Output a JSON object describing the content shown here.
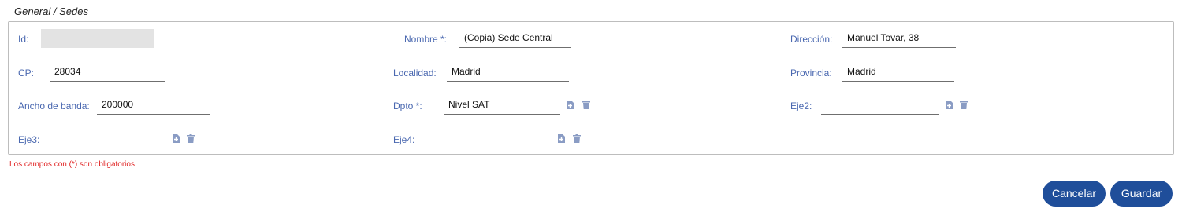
{
  "breadcrumb": "General / Sedes",
  "fields": {
    "id": {
      "label": "Id:",
      "value": ""
    },
    "nombre": {
      "label": "Nombre *:",
      "value": "(Copia) Sede Central"
    },
    "direccion": {
      "label": "Dirección:",
      "value": "Manuel Tovar, 38"
    },
    "cp": {
      "label": "CP:",
      "value": "28034"
    },
    "localidad": {
      "label": "Localidad:",
      "value": "Madrid"
    },
    "provincia": {
      "label": "Provincia:",
      "value": "Madrid"
    },
    "ancho_banda": {
      "label": "Ancho de banda:",
      "value": "200000"
    },
    "dpto": {
      "label": "Dpto *:",
      "value": "Nivel SAT"
    },
    "eje2": {
      "label": "Eje2:",
      "value": ""
    },
    "eje3": {
      "label": "Eje3:",
      "value": ""
    },
    "eje4": {
      "label": "Eje4:",
      "value": ""
    }
  },
  "required_note": "Los campos con (*) son obligatorios",
  "buttons": {
    "cancel": "Cancelar",
    "save": "Guardar"
  },
  "icons": {
    "add": "add-file-icon",
    "delete": "trash-icon"
  },
  "colors": {
    "label": "#4a68b0",
    "button": "#1f4e9a",
    "required_note": "#e02020",
    "icon": "#8a9cc4"
  }
}
